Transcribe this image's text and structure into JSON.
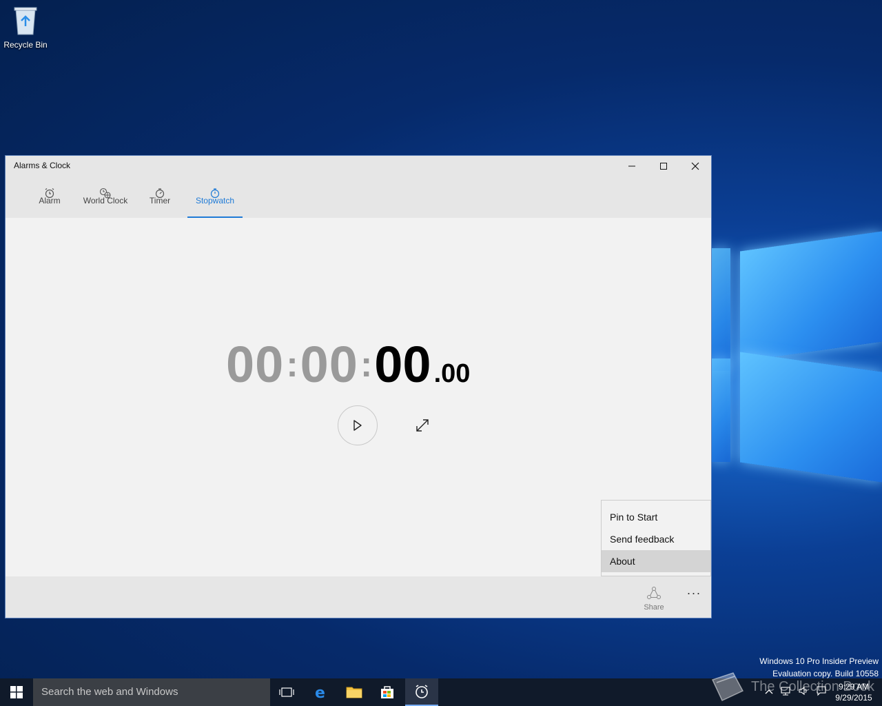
{
  "desktop": {
    "recycle_bin_label": "Recycle Bin",
    "eval_line1": "Windows 10 Pro Insider Preview",
    "eval_line2": "Evaluation copy. Build 10558",
    "watermark_text": "The Collection Book"
  },
  "window": {
    "title": "Alarms & Clock",
    "tabs": [
      {
        "label": "Alarm",
        "icon": "alarm-clock-icon"
      },
      {
        "label": "World Clock",
        "icon": "world-clock-icon"
      },
      {
        "label": "Timer",
        "icon": "timer-icon"
      },
      {
        "label": "Stopwatch",
        "icon": "stopwatch-icon"
      }
    ],
    "active_tab": "Stopwatch",
    "accent_color": "#1e7ad6"
  },
  "stopwatch": {
    "hours": "00",
    "minutes": "00",
    "seconds": "00",
    "hundredths": ".00",
    "separator": ":"
  },
  "bottombar": {
    "share_label": "Share",
    "more_label": "···"
  },
  "menu": {
    "items": [
      "Pin to Start",
      "Send feedback",
      "About"
    ],
    "highlighted": "About"
  },
  "taskbar": {
    "search_placeholder": "Search the web and Windows",
    "time": "9:29 AM",
    "date": "9/29/2015"
  }
}
